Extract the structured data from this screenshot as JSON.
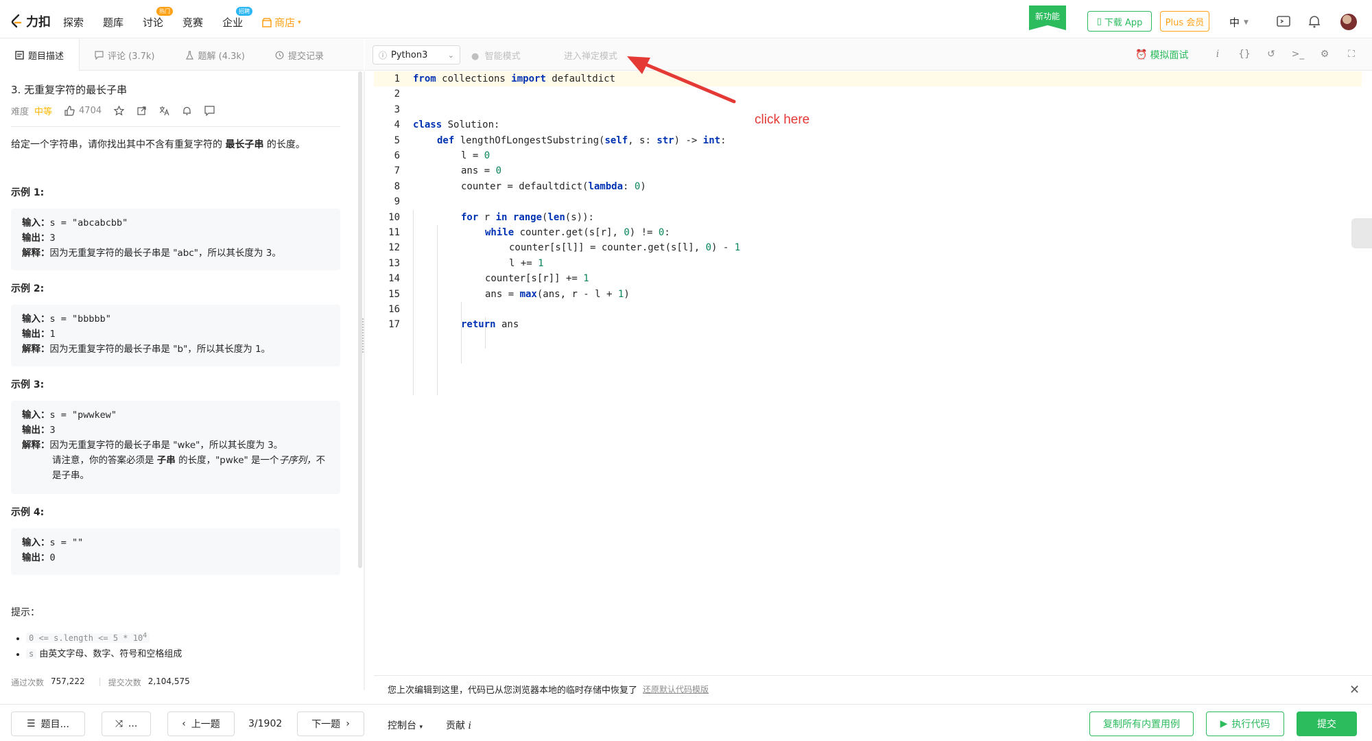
{
  "topnav": {
    "logo_text": "力扣",
    "items": [
      {
        "label": "探索"
      },
      {
        "label": "题库"
      },
      {
        "label": "讨论",
        "badge": "热门"
      },
      {
        "label": "竞赛"
      },
      {
        "label": "企业",
        "badge": "招聘"
      }
    ],
    "store_label": "商店",
    "new_feature": "新功能",
    "download_app": "下载 App",
    "plus": "Plus 会员",
    "language": "中"
  },
  "left_tabs": [
    {
      "label": "题目描述"
    },
    {
      "label": "评论 (3.7k)"
    },
    {
      "label": "题解 (4.3k)"
    },
    {
      "label": "提交记录"
    }
  ],
  "editor_bar": {
    "language": "Python3",
    "smart_mode": "智能模式",
    "zen_mode": "进入禅定模式",
    "mock_interview": "模拟面试"
  },
  "problem": {
    "title": "3. 无重复字符的最长子串",
    "difficulty_label": "难度",
    "difficulty": "中等",
    "likes": "4704",
    "intro_a": "给定一个字符串，请你找出其中不含有重复字符的 ",
    "intro_b": "最长子串",
    "intro_c": " 的长度。",
    "examples": [
      {
        "heading": "示例 1:",
        "input": "s = \"abcabcbb\"",
        "output": "3",
        "explain": "因为无重复字符的最长子串是 \"abc\"，所以其长度为 3。"
      },
      {
        "heading": "示例 2:",
        "input": "s = \"bbbbb\"",
        "output": "1",
        "explain": "因为无重复字符的最长子串是 \"b\"，所以其长度为 1。"
      },
      {
        "heading": "示例 3:",
        "input": "s = \"pwwkew\"",
        "output": "3",
        "explain": "因为无重复字符的最长子串是 \"wke\"，所以其长度为 3。",
        "note_a": "请注意，你的答案必须是 ",
        "note_b": "子串",
        "note_c": " 的长度，\"pwke\" 是一个",
        "note_d": "子序列，",
        "note_e": "不是子串。"
      },
      {
        "heading": "示例 4:",
        "input": "s = \"\"",
        "output": "0"
      }
    ],
    "input_label": "输入：",
    "output_label": "输出：",
    "explain_label": "解释：",
    "hints_heading": "提示：",
    "hint1_code": "0 <= s.length <= 5 * 10",
    "hint1_sup": "4",
    "hint2_code": "s",
    "hint2_text": " 由英文字母、数字、符号和空格组成",
    "accepted_label": "通过次数",
    "accepted": "757,222",
    "submitted_label": "提交次数",
    "submitted": "2,104,575"
  },
  "code_lines": [
    "1",
    "2",
    "3",
    "4",
    "5",
    "6",
    "7",
    "8",
    "9",
    "10",
    "11",
    "12",
    "13",
    "14",
    "15",
    "16",
    "17"
  ],
  "code": {
    "l1_a": "from",
    "l1_b": " collections ",
    "l1_c": "import",
    "l1_d": " defaultdict",
    "l4_a": "class",
    "l4_b": " Solution:",
    "l5_a": "def",
    "l5_b": " lengthOfLongestSubstring(",
    "l5_c": "self",
    "l5_d": ", s: ",
    "l5_e": "str",
    "l5_f": ") -> ",
    "l5_g": "int",
    "l5_h": ":",
    "l6_a": "l = ",
    "l6_b": "0",
    "l7_a": "ans = ",
    "l7_b": "0",
    "l8_a": "counter = defaultdict(",
    "l8_b": "lambda",
    "l8_c": ": ",
    "l8_d": "0",
    "l8_e": ")",
    "l10_a": "for",
    "l10_b": " r ",
    "l10_c": "in",
    "l10_d": " ",
    "l10_e": "range",
    "l10_f": "(",
    "l10_g": "len",
    "l10_h": "(s)):",
    "l11_a": "while",
    "l11_b": " counter.get(s[r], ",
    "l11_c": "0",
    "l11_d": ") != ",
    "l11_e": "0",
    "l11_f": ":",
    "l12_a": "counter[s[l]] = counter.get(s[l], ",
    "l12_b": "0",
    "l12_c": ") - ",
    "l12_d": "1",
    "l13_a": "l += ",
    "l13_b": "1",
    "l14_a": "counter[s[r]] += ",
    "l14_b": "1",
    "l15_a": "ans = ",
    "l15_b": "max",
    "l15_c": "(ans, r - l + ",
    "l15_d": "1",
    "l15_e": ")",
    "l17_a": "return",
    "l17_b": " ans"
  },
  "annotation": "click here",
  "notice": {
    "text": "您上次编辑到这里，代码已从您浏览器本地的临时存储中恢复了",
    "restore": "还原默认代码模版"
  },
  "bottom": {
    "problem_list": "题目...",
    "random": "...",
    "prev": "上一题",
    "pager": "3/1902",
    "next": "下一题",
    "console": "控制台",
    "contribute": "贡献",
    "copy_cases": "复制所有内置用例",
    "run": "执行代码",
    "submit": "提交"
  },
  "colors": {
    "accent": "#2cbb5d",
    "orange": "#ffa116",
    "annotation": "#e53935"
  }
}
